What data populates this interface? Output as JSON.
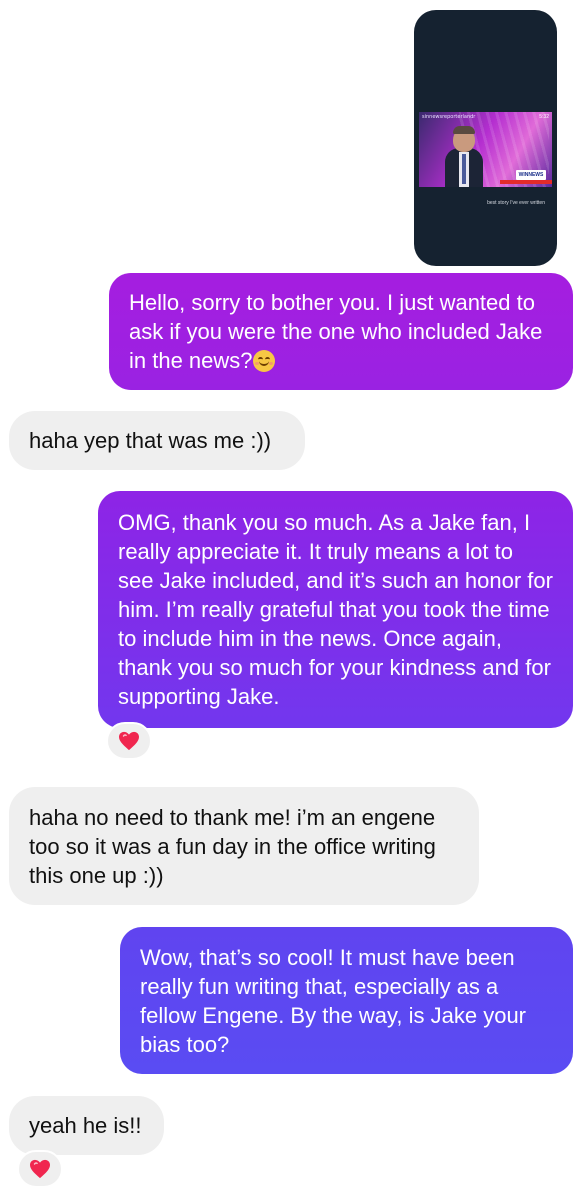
{
  "shared_story": {
    "thumbnail_topline": "sinnewsreporterlandr",
    "thumbnail_time": "5:32",
    "thumbnail_logo": "WINNEWS",
    "caption": "best story I've ever written"
  },
  "messages": [
    {
      "direction": "outgoing",
      "text": "Hello, sorry to bother you. I just wanted to ask if you were the one who included Jake in the news?",
      "emoji": "smiling-face-emoji"
    },
    {
      "direction": "incoming",
      "text": "haha yep that was me :))"
    },
    {
      "direction": "outgoing",
      "text": "OMG, thank you so much. As a Jake fan, I really appreciate it. It truly means a lot to see Jake included, and it’s such an honor for him. I’m really grateful that you took the time to include him in the news. Once again, thank you so much for your kindness and for supporting Jake.",
      "reaction": "heart"
    },
    {
      "direction": "incoming",
      "text": "haha no need to thank me! i’m an engene too so it was a fun day in the office writing this one up :))"
    },
    {
      "direction": "outgoing",
      "text": "Wow, that’s so cool! It must have been really fun writing that, especially as a fellow Engene. By the way, is Jake your bias too?"
    },
    {
      "direction": "incoming",
      "text": "yeah he is!!",
      "reaction": "heart"
    }
  ],
  "colors": {
    "outgoing_top": "#a01ee0",
    "outgoing_bottom": "#5a4cf3",
    "incoming_bg": "#efefef",
    "heart": "#f0264f"
  }
}
